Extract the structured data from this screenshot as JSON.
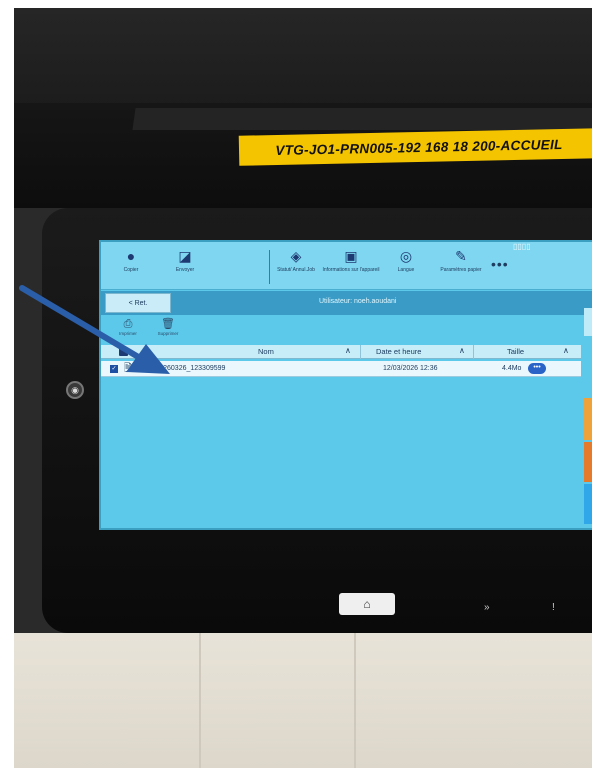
{
  "printer": {
    "label": "VTG-JO1-PRN005-192 168 18 200-ACCUEIL"
  },
  "toolbar": {
    "items": [
      {
        "label": "Copier",
        "icon": "copy-icon"
      },
      {
        "label": "Envoyer",
        "icon": "send-icon"
      },
      {
        "label": "Statut/ Annul.Job",
        "icon": "status-icon"
      },
      {
        "label": "Informations sur l'appareil",
        "icon": "device-info-icon"
      },
      {
        "label": "Langue",
        "icon": "language-icon"
      },
      {
        "label": "Paramètres papier",
        "icon": "paper-settings-icon"
      }
    ],
    "more": "•••"
  },
  "nav": {
    "back_label": "< Ret.",
    "user_label": "Utilisateur: noeh.aoudani"
  },
  "actions": {
    "print_label": "Imprimer",
    "delete_label": "Supprimer"
  },
  "table": {
    "columns": [
      "Nom",
      "Date et heure",
      "Taille"
    ],
    "rows": [
      {
        "name": "Doc_20260326_123309599",
        "date": "12/03/2026 12:36",
        "size": "4.4Mo",
        "more": "•••"
      }
    ]
  },
  "colors": {
    "screen": "#5cc9ea",
    "header": "#3a9cc6",
    "label_strip": "#f4c400",
    "annotation_arrow": "#2a5ea8"
  }
}
